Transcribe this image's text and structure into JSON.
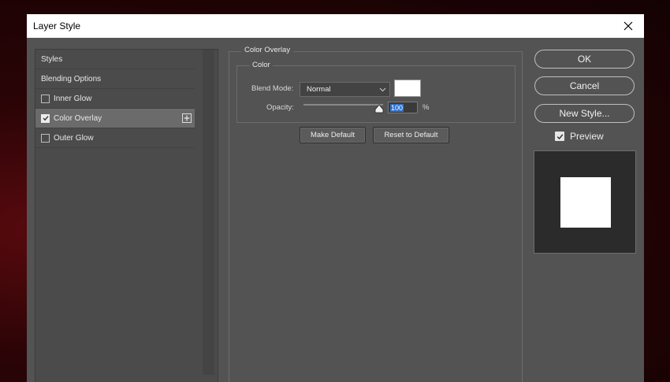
{
  "window": {
    "title": "Layer Style"
  },
  "styles_list": {
    "items": [
      {
        "label": "Styles",
        "checkbox": false,
        "checked": false,
        "selected": false
      },
      {
        "label": "Blending Options",
        "checkbox": false,
        "checked": false,
        "selected": false
      },
      {
        "label": "Inner Glow",
        "checkbox": true,
        "checked": false,
        "selected": false
      },
      {
        "label": "Color Overlay",
        "checkbox": true,
        "checked": true,
        "selected": true
      },
      {
        "label": "Outer Glow",
        "checkbox": true,
        "checked": false,
        "selected": false
      }
    ]
  },
  "panel": {
    "title": "Color Overlay",
    "section": "Color",
    "blend_mode_label": "Blend Mode:",
    "blend_mode_value": "Normal",
    "overlay_color": "#ffffff",
    "opacity_label": "Opacity:",
    "opacity_value": "100",
    "opacity_unit": "%",
    "opacity_fraction": 1.0,
    "make_default": "Make Default",
    "reset_default": "Reset to Default"
  },
  "actions": {
    "ok": "OK",
    "cancel": "Cancel",
    "new_style": "New Style...",
    "preview_label": "Preview",
    "preview_checked": true
  },
  "colors": {
    "dialog_bg": "#535353",
    "selection": "#2e6fcb",
    "preview_bg": "#2b2b2b"
  }
}
